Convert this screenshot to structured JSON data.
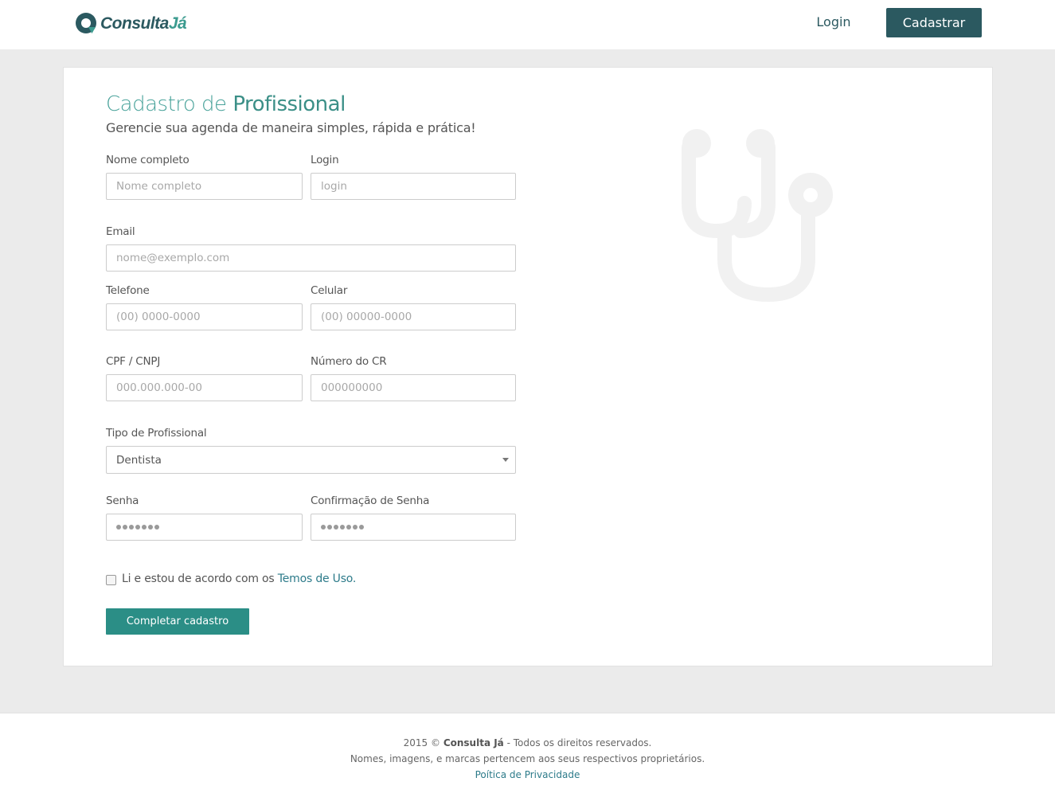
{
  "header": {
    "brand_main": "Consulta",
    "brand_accent": "Já",
    "login_label": "Login",
    "signup_label": "Cadastrar"
  },
  "form": {
    "title_prefix": "Cadastro de",
    "title_strong": "Profissional",
    "subtitle": "Gerencie sua agenda de maneira simples, rápida e prática!",
    "fields": {
      "name": {
        "label": "Nome completo",
        "placeholder": "Nome completo"
      },
      "login": {
        "label": "Login",
        "placeholder": "login"
      },
      "email": {
        "label": "Email",
        "placeholder": "nome@exemplo.com"
      },
      "phone": {
        "label": "Telefone",
        "placeholder": "(00) 0000-0000"
      },
      "mobile": {
        "label": "Celular",
        "placeholder": "(00) 00000-0000"
      },
      "cpf": {
        "label": "CPF / CNPJ",
        "placeholder": "000.000.000-00"
      },
      "cr": {
        "label": "Número do CR",
        "placeholder": "000000000"
      },
      "type": {
        "label": "Tipo de Profissional",
        "value": "Dentista"
      },
      "password": {
        "label": "Senha",
        "mask_length": 7
      },
      "password_confirm": {
        "label": "Confirmação de Senha",
        "mask_length": 7
      }
    },
    "terms_text": "Li e estou de acordo com os",
    "terms_link": "Temos de Uso.",
    "submit_label": "Completar cadastro"
  },
  "footer": {
    "year_prefix": "2015 ©",
    "company": "Consulta Já",
    "rights": "- Todos os direitos reservados.",
    "disclaimer": "Nomes, imagens, e marcas pertencem aos seus respectivos proprietários.",
    "privacy": "Poítica de Privacidade"
  },
  "colors": {
    "brand_dark": "#2b5960",
    "brand_teal": "#2b8e86",
    "title_teal": "#4aa39b",
    "link": "#2d7b8a"
  },
  "decor_icon": "stethoscope-icon"
}
